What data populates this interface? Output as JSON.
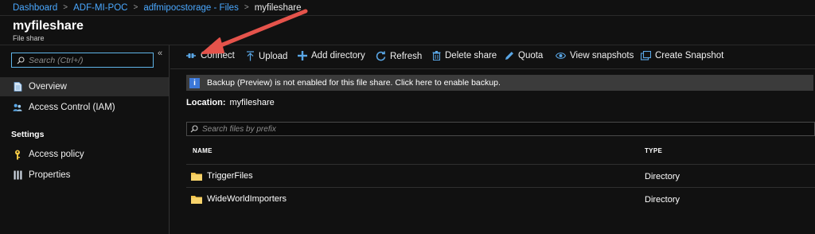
{
  "breadcrumb": [
    {
      "label": "Dashboard",
      "link": true
    },
    {
      "label": "ADF-MI-POC",
      "link": true
    },
    {
      "label": "adfmipocstorage - Files",
      "link": true
    },
    {
      "label": "myfileshare",
      "link": false
    }
  ],
  "breadcrumb_separator": ">",
  "header": {
    "title": "myfileshare",
    "subtitle": "File share"
  },
  "sidebar": {
    "search_placeholder": "Search (Ctrl+/)",
    "collapse_glyph": "«",
    "items": [
      {
        "label": "Overview",
        "icon": "overview-doc-icon",
        "active": true
      },
      {
        "label": "Access Control (IAM)",
        "icon": "people-icon",
        "active": false
      },
      {
        "label": "Access policy",
        "icon": "key-icon",
        "active": false
      },
      {
        "label": "Properties",
        "icon": "properties-bars-icon",
        "active": false
      }
    ],
    "section_label": "Settings"
  },
  "toolbar": [
    {
      "label": "Connect",
      "icon": "connect-icon"
    },
    {
      "label": "Upload",
      "icon": "upload-icon"
    },
    {
      "label": "Add directory",
      "icon": "plus-icon"
    },
    {
      "label": "Refresh",
      "icon": "refresh-icon"
    },
    {
      "label": "Delete share",
      "icon": "trash-icon"
    },
    {
      "label": "Quota",
      "icon": "pencil-icon"
    },
    {
      "label": "View snapshots",
      "icon": "eye-icon"
    },
    {
      "label": "Create Snapshot",
      "icon": "snapshot-icon"
    }
  ],
  "banner": {
    "text": "Backup (Preview) is not enabled for this file share. Click here to enable backup.",
    "icon_glyph": "i"
  },
  "location": {
    "label": "Location:",
    "value": "myfileshare"
  },
  "file_search_placeholder": "Search files by prefix",
  "table": {
    "columns": [
      "NAME",
      "TYPE"
    ],
    "rows": [
      {
        "name": "TriggerFiles",
        "type": "Directory"
      },
      {
        "name": "WideWorldImporters",
        "type": "Directory"
      }
    ]
  },
  "colors": {
    "accent": "#4aa8ff",
    "banner_bg": "#3b3b3b",
    "info_icon": "#3c78d8",
    "annotation_arrow": "#e5534b",
    "folder": "#f0c24a"
  }
}
